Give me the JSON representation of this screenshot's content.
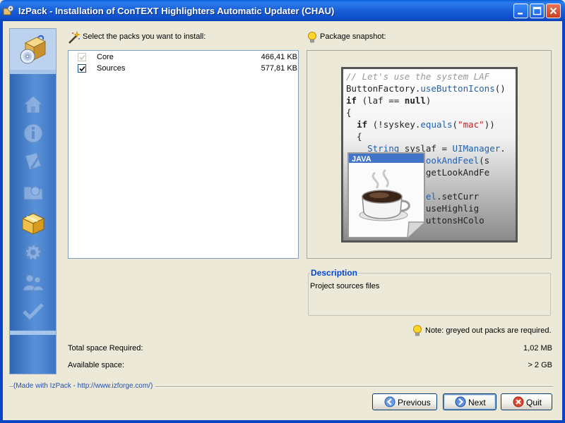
{
  "window": {
    "title": "IzPack - Installation of  ConTEXT Highlighters Automatic Updater (CHAU)",
    "controls": [
      "minimize-icon",
      "maximize-icon",
      "close-icon"
    ]
  },
  "sidebar": {
    "steps": [
      {
        "icon": "home-icon",
        "state": "disabled"
      },
      {
        "icon": "info-icon",
        "state": "disabled"
      },
      {
        "icon": "license-icon",
        "state": "disabled"
      },
      {
        "icon": "folder-icon",
        "state": "disabled"
      },
      {
        "icon": "packages-icon",
        "state": "active"
      },
      {
        "icon": "gear-icon",
        "state": "disabled"
      },
      {
        "icon": "users-icon",
        "state": "disabled"
      },
      {
        "icon": "checkmark-icon",
        "state": "disabled"
      }
    ]
  },
  "packs": {
    "heading": "Select the packs you want to install:",
    "items": [
      {
        "name": "Core",
        "size": "466,41 KB",
        "checked": true,
        "greyed": true
      },
      {
        "name": "Sources",
        "size": "577,81 KB",
        "checked": true,
        "greyed": false
      }
    ]
  },
  "snapshot": {
    "heading": "Package snapshot:",
    "code_lines": [
      "// Let's use the system LAF",
      "ButtonFactory.useButtonIcons()",
      "if (laf == null)",
      "{",
      "  if (!syskey.equals(\"mac\"))",
      "  {",
      "    String syslaf = UIManager.",
      "           setLookAndFeel(s",
      "           ger.getLookAndFe",
      "",
      "         kAndFeel.setCurr",
      "         ctory.useHighlig",
      "         data.buttonsHColo",
      "",
      "  }"
    ],
    "java_label": "JAVA"
  },
  "description": {
    "title": "Description",
    "text": "Project sources files"
  },
  "note": "Note: greyed out packs are required.",
  "space": {
    "required_label": "Total space Required:",
    "required_value": "1,02 MB",
    "available_label": "Available space:",
    "available_value": "> 2 GB"
  },
  "footer": {
    "made_with": "(Made with IzPack - http://www.izforge.com/)",
    "previous": "Previous",
    "next": "Next",
    "quit": "Quit"
  },
  "colors": {
    "title_bar": "#1a5fd6",
    "accent_link": "#0046d5",
    "sidebar": "#4a82cf"
  }
}
